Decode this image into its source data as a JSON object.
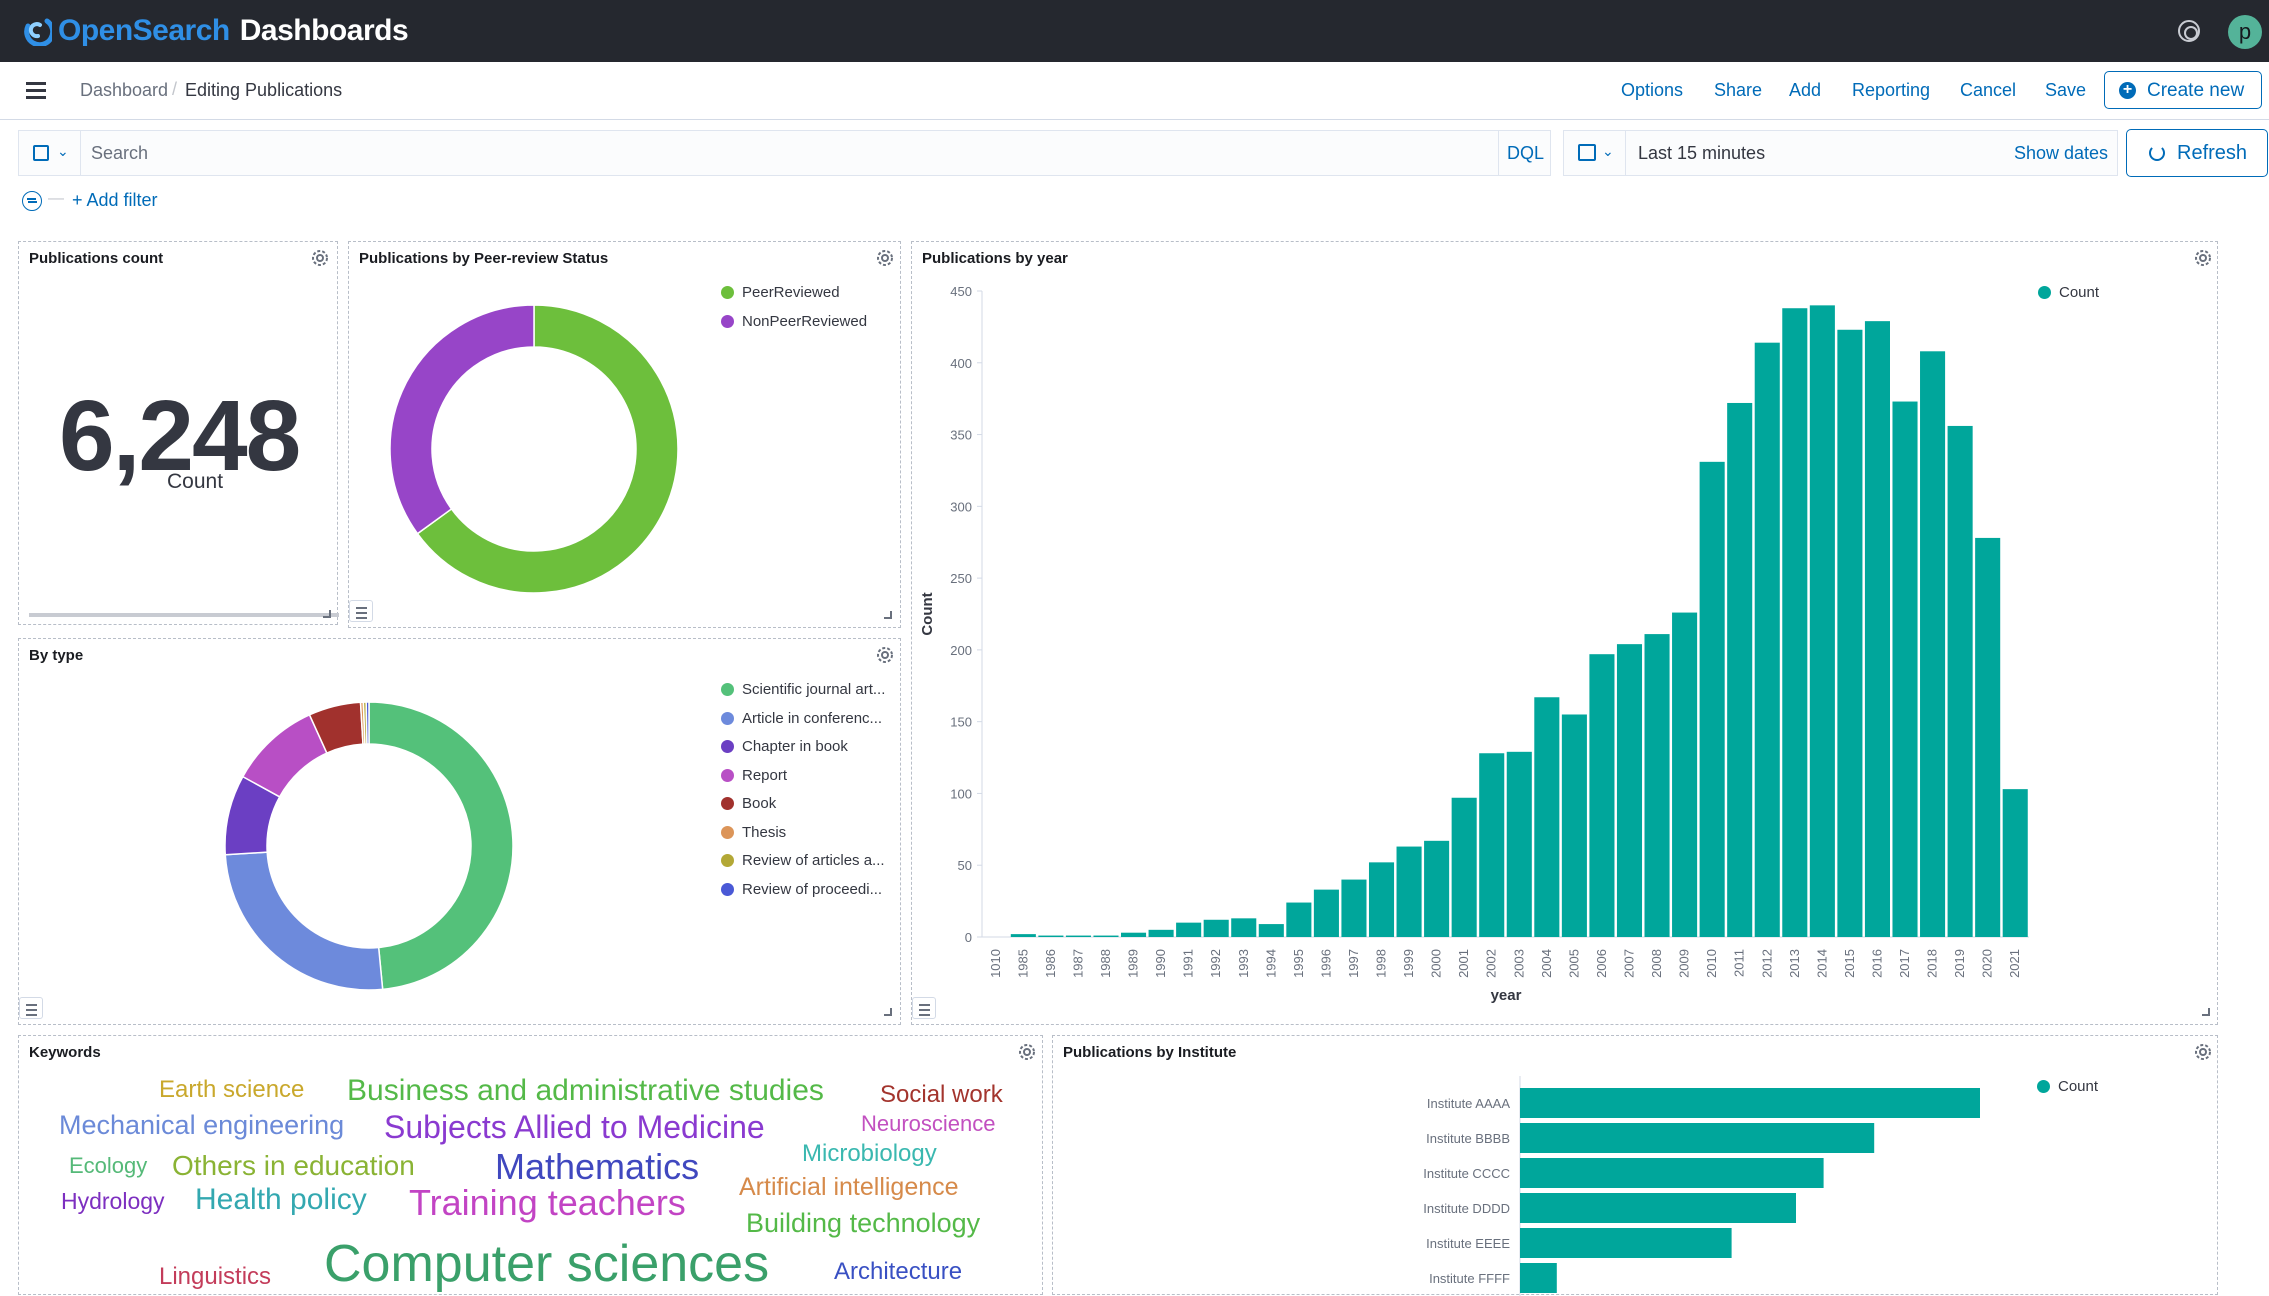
{
  "app": {
    "brand_open": "Open",
    "brand_search": "Search",
    "brand_dashboards": "Dashboards",
    "avatar_initial": "p"
  },
  "breadcrumb": {
    "parent": "Dashboard",
    "separator": "/",
    "current": "Editing Publications"
  },
  "header_actions": [
    "Options",
    "Share",
    "Add",
    "Reporting",
    "Cancel",
    "Save"
  ],
  "create_new_label": "Create new",
  "query": {
    "placeholder": "Search",
    "language": "DQL",
    "time_range": "Last 15 minutes",
    "show_dates": "Show dates",
    "refresh": "Refresh"
  },
  "filter": {
    "add_filter": "+ Add filter",
    "dash": "—"
  },
  "panels": {
    "count": {
      "title": "Publications count",
      "value": "6,248",
      "label": "Count"
    },
    "peer": {
      "title": "Publications by Peer-review Status"
    },
    "year": {
      "title": "Publications by year"
    },
    "type": {
      "title": "By type"
    },
    "keywords": {
      "title": "Keywords"
    },
    "institute": {
      "title": "Publications by Institute"
    }
  },
  "chart_data": [
    {
      "type": "pie",
      "title": "Publications by Peer-review Status",
      "labels": [
        "PeerReviewed",
        "NonPeerReviewed"
      ],
      "values": [
        65,
        35
      ],
      "colors": [
        "#6dbf3c",
        "#9745c8"
      ],
      "donut": true,
      "legend": "top-right"
    },
    {
      "type": "bar",
      "title": "Publications by year",
      "xlabel": "year",
      "ylabel": "Count",
      "categories": [
        "1010",
        "1985",
        "1986",
        "1987",
        "1988",
        "1989",
        "1990",
        "1991",
        "1992",
        "1993",
        "1994",
        "1995",
        "1996",
        "1997",
        "1998",
        "1999",
        "2000",
        "2001",
        "2002",
        "2003",
        "2004",
        "2005",
        "2006",
        "2007",
        "2008",
        "2009",
        "2010",
        "2011",
        "2012",
        "2013",
        "2014",
        "2015",
        "2016",
        "2017",
        "2018",
        "2019",
        "2020",
        "2021"
      ],
      "series": [
        {
          "name": "Count",
          "values": [
            0,
            2,
            1,
            1,
            1,
            3,
            5,
            10,
            12,
            13,
            9,
            24,
            33,
            40,
            52,
            63,
            67,
            97,
            128,
            129,
            167,
            155,
            197,
            204,
            211,
            226,
            331,
            372,
            414,
            438,
            440,
            423,
            429,
            373,
            408,
            356,
            278,
            103
          ]
        }
      ],
      "ylim": [
        0,
        450
      ],
      "yticks": [
        0,
        50,
        100,
        150,
        200,
        250,
        300,
        350,
        400,
        450
      ],
      "color": "#00a69b",
      "legend": "top-right"
    },
    {
      "type": "pie",
      "title": "By type",
      "labels": [
        "Scientific journal art...",
        "Article in conferenc...",
        "Chapter in book",
        "Report",
        "Book",
        "Thesis",
        "Review of articles a...",
        "Review of proceedi..."
      ],
      "values": [
        46.5,
        24.5,
        8.6,
        9.8,
        5.6,
        0.3,
        0.3,
        0.3
      ],
      "colors": [
        "#54c17a",
        "#6d8adc",
        "#6b3fc3",
        "#b84fc5",
        "#a1312d",
        "#dc9559",
        "#b3a836",
        "#4a59d6"
      ],
      "donut": true,
      "legend": "right"
    },
    {
      "type": "bar",
      "orientation": "horizontal",
      "title": "Publications by Institute",
      "categories": [
        "Institute AAAA",
        "Institute BBBB",
        "Institute CCCC",
        "Institute DDDD",
        "Institute EEEE",
        "Institute FFFF"
      ],
      "series": [
        {
          "name": "Count",
          "values": [
            100,
            77,
            66,
            60,
            46,
            8
          ]
        }
      ],
      "color": "#00a69b",
      "legend": "top-right"
    }
  ],
  "keywords": [
    {
      "text": "Earth science",
      "color": "#c9a82c"
    },
    {
      "text": "Business and administrative studies",
      "color": "#54b948"
    },
    {
      "text": "Social work",
      "color": "#a3342d"
    },
    {
      "text": "Mechanical engineering",
      "color": "#6b8ad8"
    },
    {
      "text": "Subjects Allied to Medicine",
      "color": "#8a3ad0"
    },
    {
      "text": "Neuroscience",
      "color": "#c250c0"
    },
    {
      "text": "Ecology",
      "color": "#55b978"
    },
    {
      "text": "Others in education",
      "color": "#8ab334"
    },
    {
      "text": "Mathematics",
      "color": "#4048bf"
    },
    {
      "text": "Microbiology",
      "color": "#3ab8b0"
    },
    {
      "text": "Hydrology",
      "color": "#7d2fc0"
    },
    {
      "text": "Health policy",
      "color": "#33a8b0"
    },
    {
      "text": "Training teachers",
      "color": "#c244c4"
    },
    {
      "text": "Artificial intelligence",
      "color": "#d68a4a"
    },
    {
      "text": "Building technology",
      "color": "#54b948"
    },
    {
      "text": "Linguistics",
      "color": "#c33c5a"
    },
    {
      "text": "Computer sciences",
      "color": "#3aa06a"
    },
    {
      "text": "Architecture",
      "color": "#3950c3"
    }
  ]
}
